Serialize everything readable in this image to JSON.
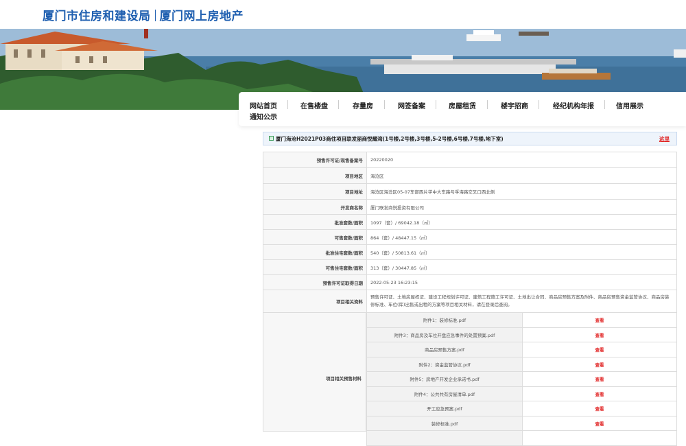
{
  "header": {
    "site_name_1": "厦门市住房和建设局",
    "site_name_2": "厦门网上房地产"
  },
  "nav": {
    "items": [
      "网站首页",
      "在售楼盘",
      "存量房",
      "网签备案",
      "房屋租赁",
      "楼宇招商",
      "经纪机构年报",
      "信用展示",
      "通知公示"
    ]
  },
  "project": {
    "title": "厦门海沧H2021P03商住项目联发丽商悦耀湾(1号楼,2号楼,3号楼,5-2号楼,6号楼,7号楼,地下室)",
    "back_label": "这里"
  },
  "info": {
    "rows": [
      {
        "label": "预售许可证/现售备案号",
        "value": "20220020"
      },
      {
        "label": "项目地区",
        "value": "海沧区"
      },
      {
        "label": "项目地址",
        "value": "海沧区海沧区05-07东部西片学中大东路与孚海路交叉口西北侧"
      },
      {
        "label": "开发商名称",
        "value": "厦门联发商悦投资有限公司"
      },
      {
        "label": "批准套数/面积",
        "value": "1097（套）/ 69042.18（㎡）"
      },
      {
        "label": "可售套数/面积",
        "value": "864（套）/ 48447.15（㎡）"
      },
      {
        "label": "批准住宅套数/面积",
        "value": "540（套）/ 50813.61（㎡）"
      },
      {
        "label": "可售住宅套数/面积",
        "value": "313（套）/ 30447.85（㎡）"
      },
      {
        "label": "预售许可证取得日期",
        "value": "2022-05-23 16:23:15"
      }
    ],
    "related_info_label": "项目相关资料",
    "related_info_value": "预售许可证、土地房屋权证、建设工程规划许可证、建筑工程施工许可证、土地出让合同、商品房预售方案及附件、商品房预售资金监管协议、商品房装修标准、车位(库)出售或出租的方案等项目相关材料，请在登录后查阅。"
  },
  "attachments": {
    "label": "项目相关预售材料",
    "view_label": "查看",
    "files": [
      "附件1：装修标准.pdf",
      "附件3：商品房及车位开盘应急事件的处置预案.pdf",
      "商品房预售方案.pdf",
      "附件2：资金监管协议.pdf",
      "附件5：房地产开发企业承诺书.pdf",
      "附件4：公共共有房屋清单.pdf",
      "开工应急预案.pdf",
      "装修标准.pdf",
      ""
    ]
  },
  "colors": {
    "brand_blue": "#1f5fb0",
    "link_red": "#e02020",
    "label_bg": "#f7f7f7",
    "title_bg": "#eef4fb"
  }
}
